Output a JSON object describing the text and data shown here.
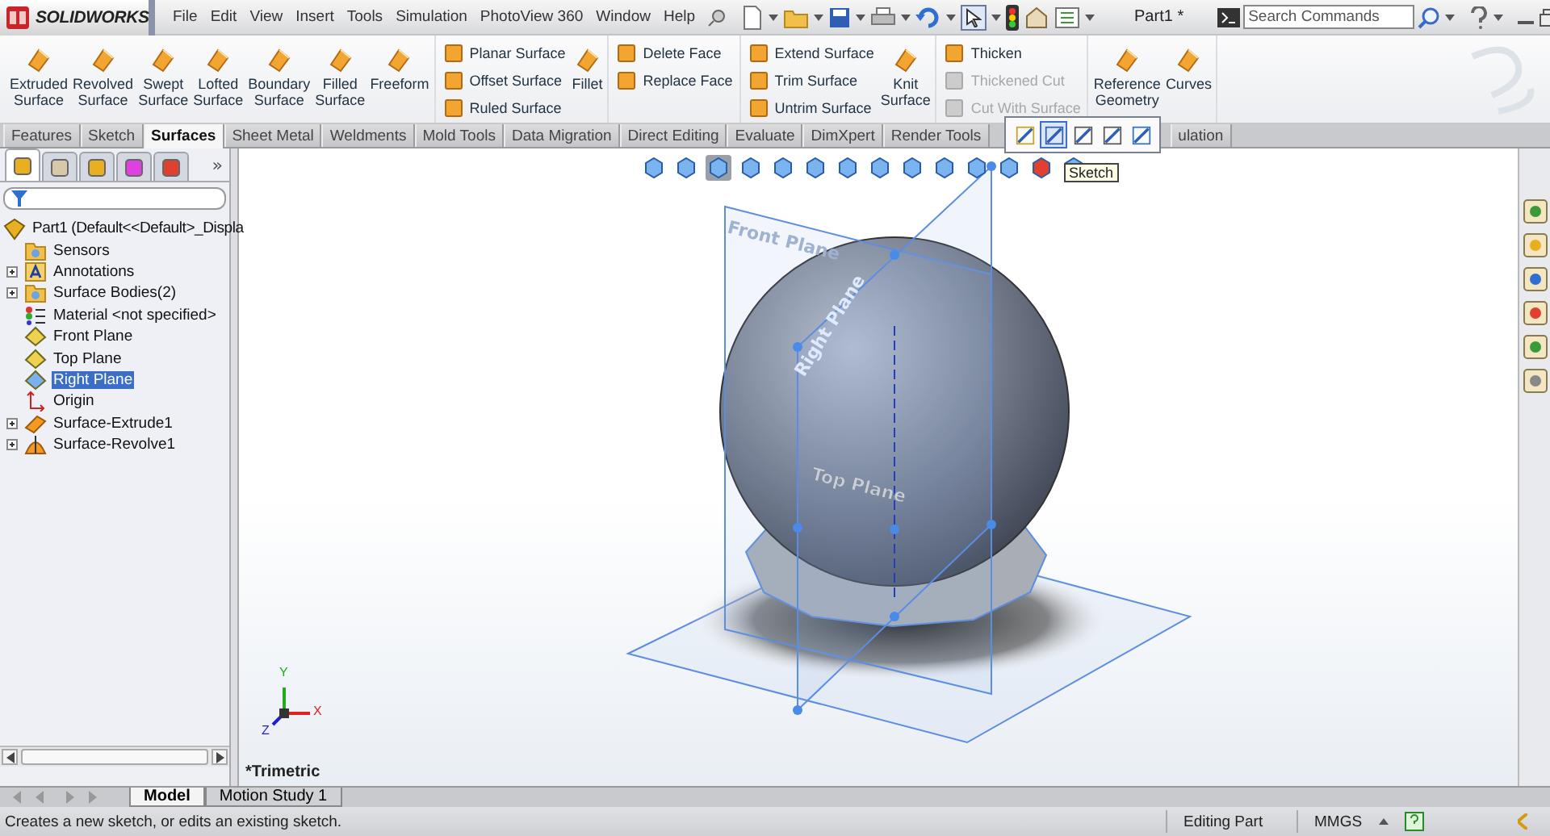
{
  "app": {
    "name": "SOLIDWORKS"
  },
  "menu": [
    "File",
    "Edit",
    "View",
    "Insert",
    "Tools",
    "Simulation",
    "PhotoView 360",
    "Window",
    "Help"
  ],
  "document_title": "Part1 *",
  "search": {
    "placeholder": "Search Commands"
  },
  "ribbon": [
    {
      "columns": [
        {
          "kind": "large",
          "items": [
            {
              "label": "Extruded\nSurface",
              "disabled": false
            }
          ]
        },
        {
          "kind": "large",
          "items": [
            {
              "label": "Revolved\nSurface",
              "disabled": false
            }
          ]
        },
        {
          "kind": "large",
          "items": [
            {
              "label": "Swept\nSurface",
              "disabled": false
            }
          ]
        },
        {
          "kind": "large",
          "items": [
            {
              "label": "Lofted\nSurface",
              "disabled": false
            }
          ]
        },
        {
          "kind": "large",
          "items": [
            {
              "label": "Boundary\nSurface",
              "disabled": false
            }
          ]
        },
        {
          "kind": "large",
          "items": [
            {
              "label": "Filled\nSurface",
              "disabled": false
            }
          ]
        },
        {
          "kind": "large",
          "items": [
            {
              "label": "Freeform",
              "disabled": false
            }
          ]
        }
      ]
    },
    {
      "columns": [
        {
          "kind": "stack",
          "items": [
            {
              "label": "Planar Surface",
              "disabled": false
            },
            {
              "label": "Offset Surface",
              "disabled": false
            },
            {
              "label": "Ruled Surface",
              "disabled": false
            }
          ]
        },
        {
          "kind": "large",
          "items": [
            {
              "label": "Fillet",
              "disabled": false
            }
          ]
        }
      ]
    },
    {
      "columns": [
        {
          "kind": "stack",
          "items": [
            {
              "label": "Delete Face",
              "disabled": false
            },
            {
              "label": "Replace Face",
              "disabled": false
            }
          ]
        }
      ]
    },
    {
      "columns": [
        {
          "kind": "stack",
          "items": [
            {
              "label": "Extend Surface",
              "disabled": false
            },
            {
              "label": "Trim Surface",
              "disabled": false
            },
            {
              "label": "Untrim Surface",
              "disabled": false
            }
          ]
        },
        {
          "kind": "large",
          "items": [
            {
              "label": "Knit\nSurface",
              "disabled": false
            }
          ]
        }
      ]
    },
    {
      "columns": [
        {
          "kind": "stack",
          "items": [
            {
              "label": "Thicken",
              "disabled": false
            },
            {
              "label": "Thickened Cut",
              "disabled": true
            },
            {
              "label": "Cut With Surface",
              "disabled": true
            }
          ]
        }
      ]
    },
    {
      "columns": [
        {
          "kind": "large",
          "items": [
            {
              "label": "Reference\nGeometry",
              "disabled": false
            }
          ]
        },
        {
          "kind": "large",
          "items": [
            {
              "label": "Curves",
              "disabled": false
            }
          ]
        }
      ]
    }
  ],
  "command_tabs": [
    {
      "label": "Features",
      "selected": false
    },
    {
      "label": "Sketch",
      "selected": false
    },
    {
      "label": "Surfaces",
      "selected": true
    },
    {
      "label": "Sheet Metal",
      "selected": false
    },
    {
      "label": "Weldments",
      "selected": false
    },
    {
      "label": "Mold Tools",
      "selected": false
    },
    {
      "label": "Data Migration",
      "selected": false
    },
    {
      "label": "Direct Editing",
      "selected": false
    },
    {
      "label": "Evaluate",
      "selected": false
    },
    {
      "label": "DimXpert",
      "selected": false
    },
    {
      "label": "Render Tools",
      "selected": false
    },
    {
      "label": "ulation",
      "selected": false
    }
  ],
  "popup_toolbar": {
    "tools": [
      {
        "selected": false
      },
      {
        "selected": true
      },
      {
        "selected": false
      },
      {
        "selected": false
      },
      {
        "selected": false
      }
    ],
    "tooltip": "Sketch"
  },
  "feature_manager": {
    "tabs": [
      {
        "selected": true
      },
      {
        "selected": false
      },
      {
        "selected": false
      },
      {
        "selected": false
      },
      {
        "selected": false
      }
    ],
    "more": "»",
    "tree": {
      "label": "Part1  (Default<<Default>_Displa",
      "children": [
        {
          "label": "Sensors",
          "kind": "folder",
          "expandable": false,
          "selected": false
        },
        {
          "label": "Annotations",
          "kind": "annotation",
          "expandable": true,
          "selected": false
        },
        {
          "label": "Surface Bodies(2)",
          "kind": "folder",
          "expandable": true,
          "selected": false
        },
        {
          "label": "Material <not specified>",
          "kind": "material",
          "expandable": false,
          "selected": false
        },
        {
          "label": "Front Plane",
          "kind": "plane",
          "expandable": false,
          "selected": false
        },
        {
          "label": "Top Plane",
          "kind": "plane",
          "expandable": false,
          "selected": false
        },
        {
          "label": "Right Plane",
          "kind": "plane",
          "expandable": false,
          "selected": true
        },
        {
          "label": "Origin",
          "kind": "origin",
          "expandable": false,
          "selected": false
        },
        {
          "label": "Surface-Extrude1",
          "kind": "feature",
          "expandable": true,
          "selected": false
        },
        {
          "label": "Surface-Revolve1",
          "kind": "revolve",
          "expandable": true,
          "selected": false
        }
      ]
    }
  },
  "viewport": {
    "view_name": "*Trimetric",
    "plane_labels": [
      "Front Plane",
      "Right Plane",
      "Top Plane"
    ],
    "triad": [
      "Y",
      "X",
      "Z"
    ]
  },
  "bottom_tabs": [
    {
      "label": "Model",
      "selected": true
    },
    {
      "label": "Motion Study 1",
      "selected": false
    }
  ],
  "status_bar": {
    "message": "Creates a new sketch, or edits an existing sketch.",
    "mode": "Editing Part",
    "units": "MMGS"
  }
}
